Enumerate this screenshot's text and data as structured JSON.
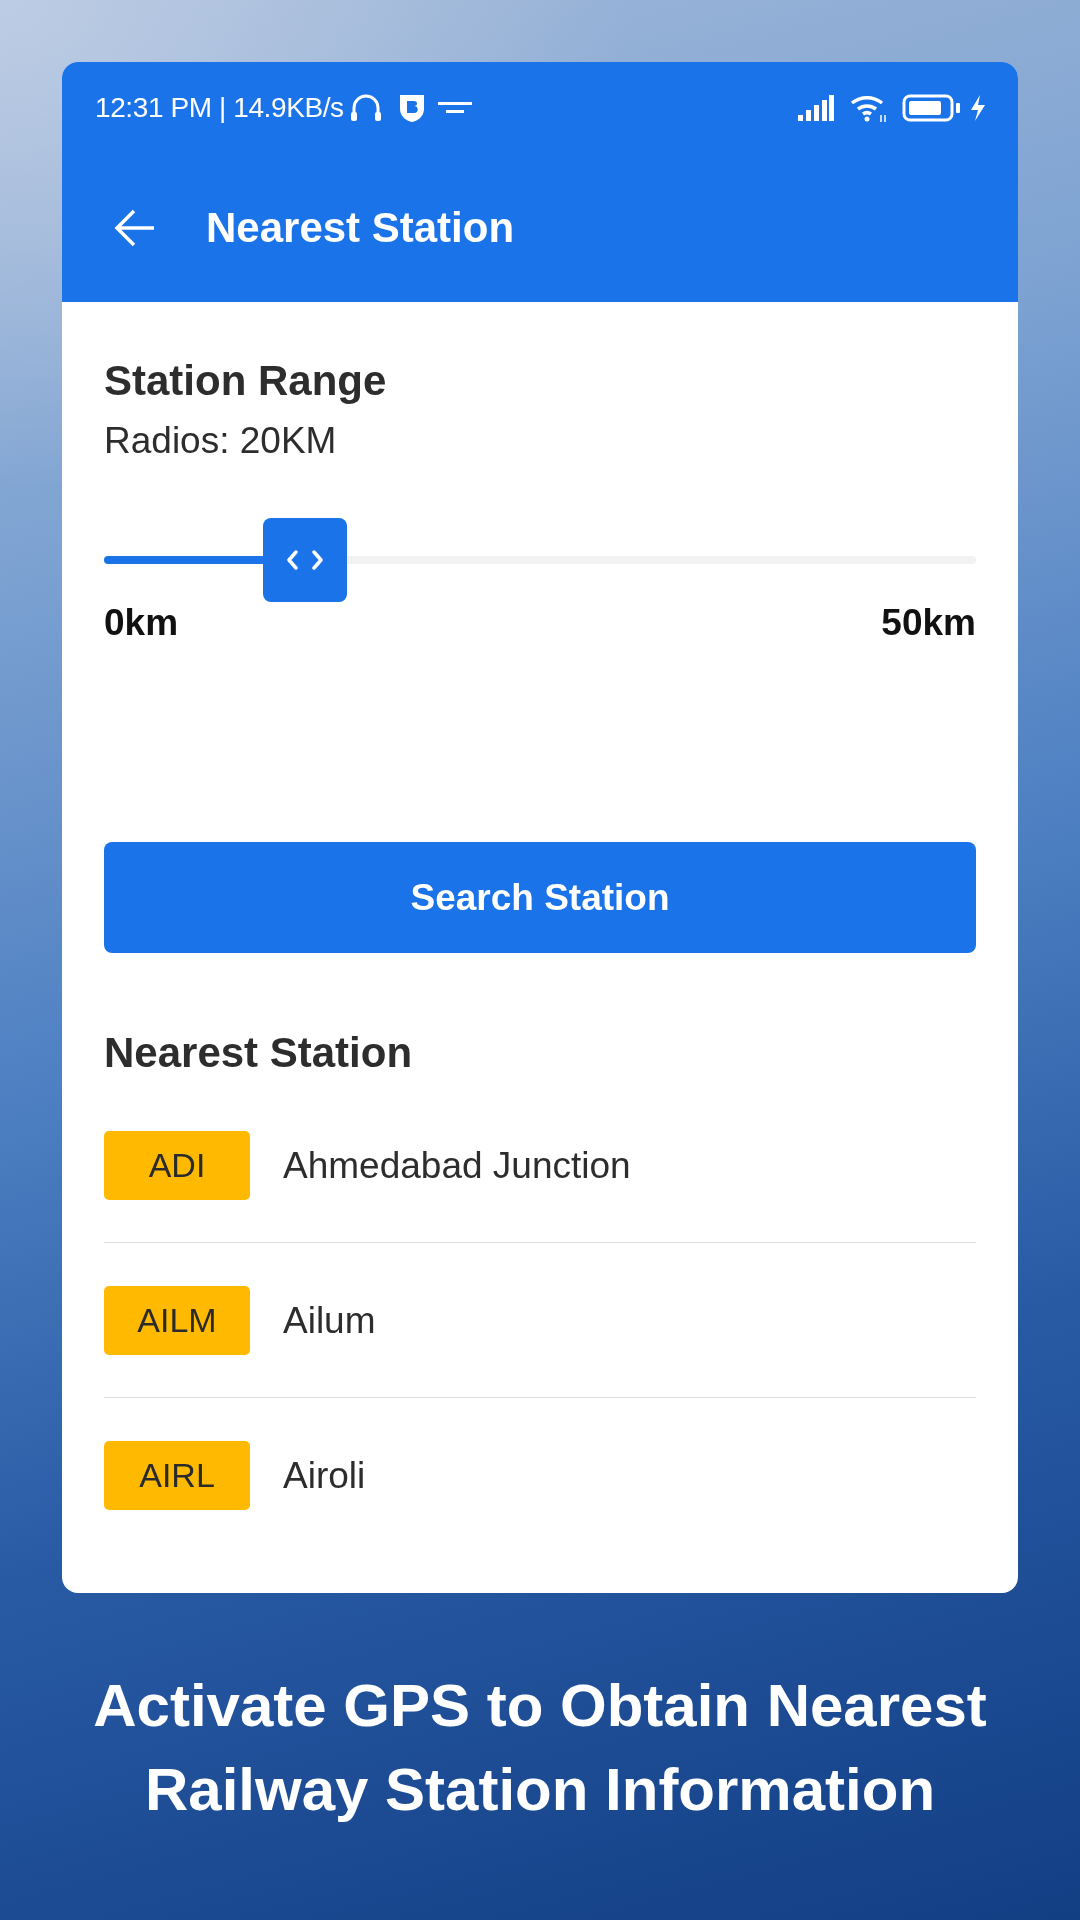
{
  "status_bar": {
    "text": "12:31 PM | 14.9KB/s"
  },
  "app_bar": {
    "title": "Nearest Station"
  },
  "range": {
    "title": "Station Range",
    "radius_label": "Radios: 20KM",
    "slider": {
      "level": 0.23,
      "min_label": "0km",
      "max_label": "50km"
    }
  },
  "search_button": {
    "label": "Search Station"
  },
  "results": {
    "title": "Nearest Station",
    "stations": [
      {
        "code": "ADI",
        "name": "Ahmedabad Junction"
      },
      {
        "code": "AILM",
        "name": "Ailum"
      },
      {
        "code": "AIRL",
        "name": "Airoli"
      }
    ]
  },
  "caption": "Activate GPS to Obtain Nearest Railway Station Information"
}
